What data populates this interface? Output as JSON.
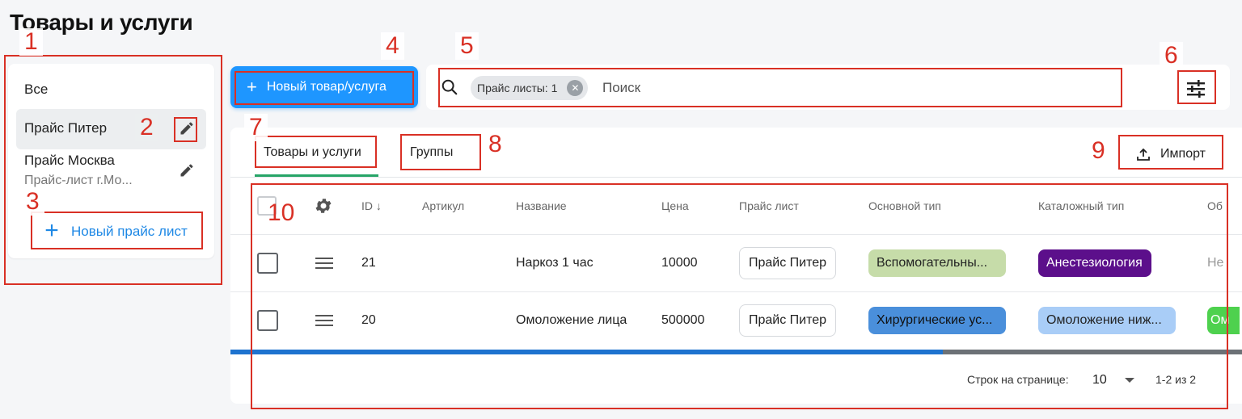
{
  "page": {
    "title": "Товары и услуги"
  },
  "sidebar": {
    "items": [
      {
        "label": "Все"
      },
      {
        "label": "Прайс Питер"
      },
      {
        "label": "Прайс Москва",
        "sub": "Прайс-лист г.Мо..."
      }
    ],
    "new_pricelist_label": "Новый прайс лист"
  },
  "toolbar": {
    "new_item_label": "Новый товар/услуга",
    "filter_chip": "Прайс листы: 1",
    "search_placeholder": "Поиск"
  },
  "tabs": [
    {
      "label": "Товары и услуги",
      "active": true
    },
    {
      "label": "Группы",
      "active": false
    }
  ],
  "import_label": "Импорт",
  "table": {
    "columns": [
      "ID",
      "Артикул",
      "Название",
      "Цена",
      "Прайс лист",
      "Основной тип",
      "Каталожный тип",
      "Об"
    ],
    "rows": [
      {
        "id": "21",
        "article": "",
        "name": "Наркоз 1 час",
        "price": "10000",
        "pricelist": "Прайс Питер",
        "main_type": {
          "label": "Вспомогательны...",
          "bg": "#c6dca9",
          "fg": "#222222"
        },
        "catalog_type": {
          "label": "Анестезиология",
          "bg": "#5c0f8b",
          "fg": "#ffffff"
        },
        "extra": "Не"
      },
      {
        "id": "20",
        "article": "",
        "name": "Омоложение лица",
        "price": "500000",
        "pricelist": "Прайс Питер",
        "main_type": {
          "label": "Хирургические ус...",
          "bg": "#4a8fdb",
          "fg": "#111111"
        },
        "catalog_type": {
          "label": "Омоложение ниж...",
          "bg": "#a9cdf7",
          "fg": "#222222"
        },
        "extra": "Ом"
      }
    ]
  },
  "pagination": {
    "rows_label": "Строк на странице:",
    "rows_value": "10",
    "range": "1-2 из 2"
  },
  "annotations": [
    "1",
    "2",
    "3",
    "4",
    "5",
    "6",
    "7",
    "8",
    "9",
    "10"
  ],
  "colors": {
    "accent": "#1e96ff",
    "annotation": "#d93025",
    "tab_active": "#27a567",
    "scrollbar": "#1e73cf"
  }
}
